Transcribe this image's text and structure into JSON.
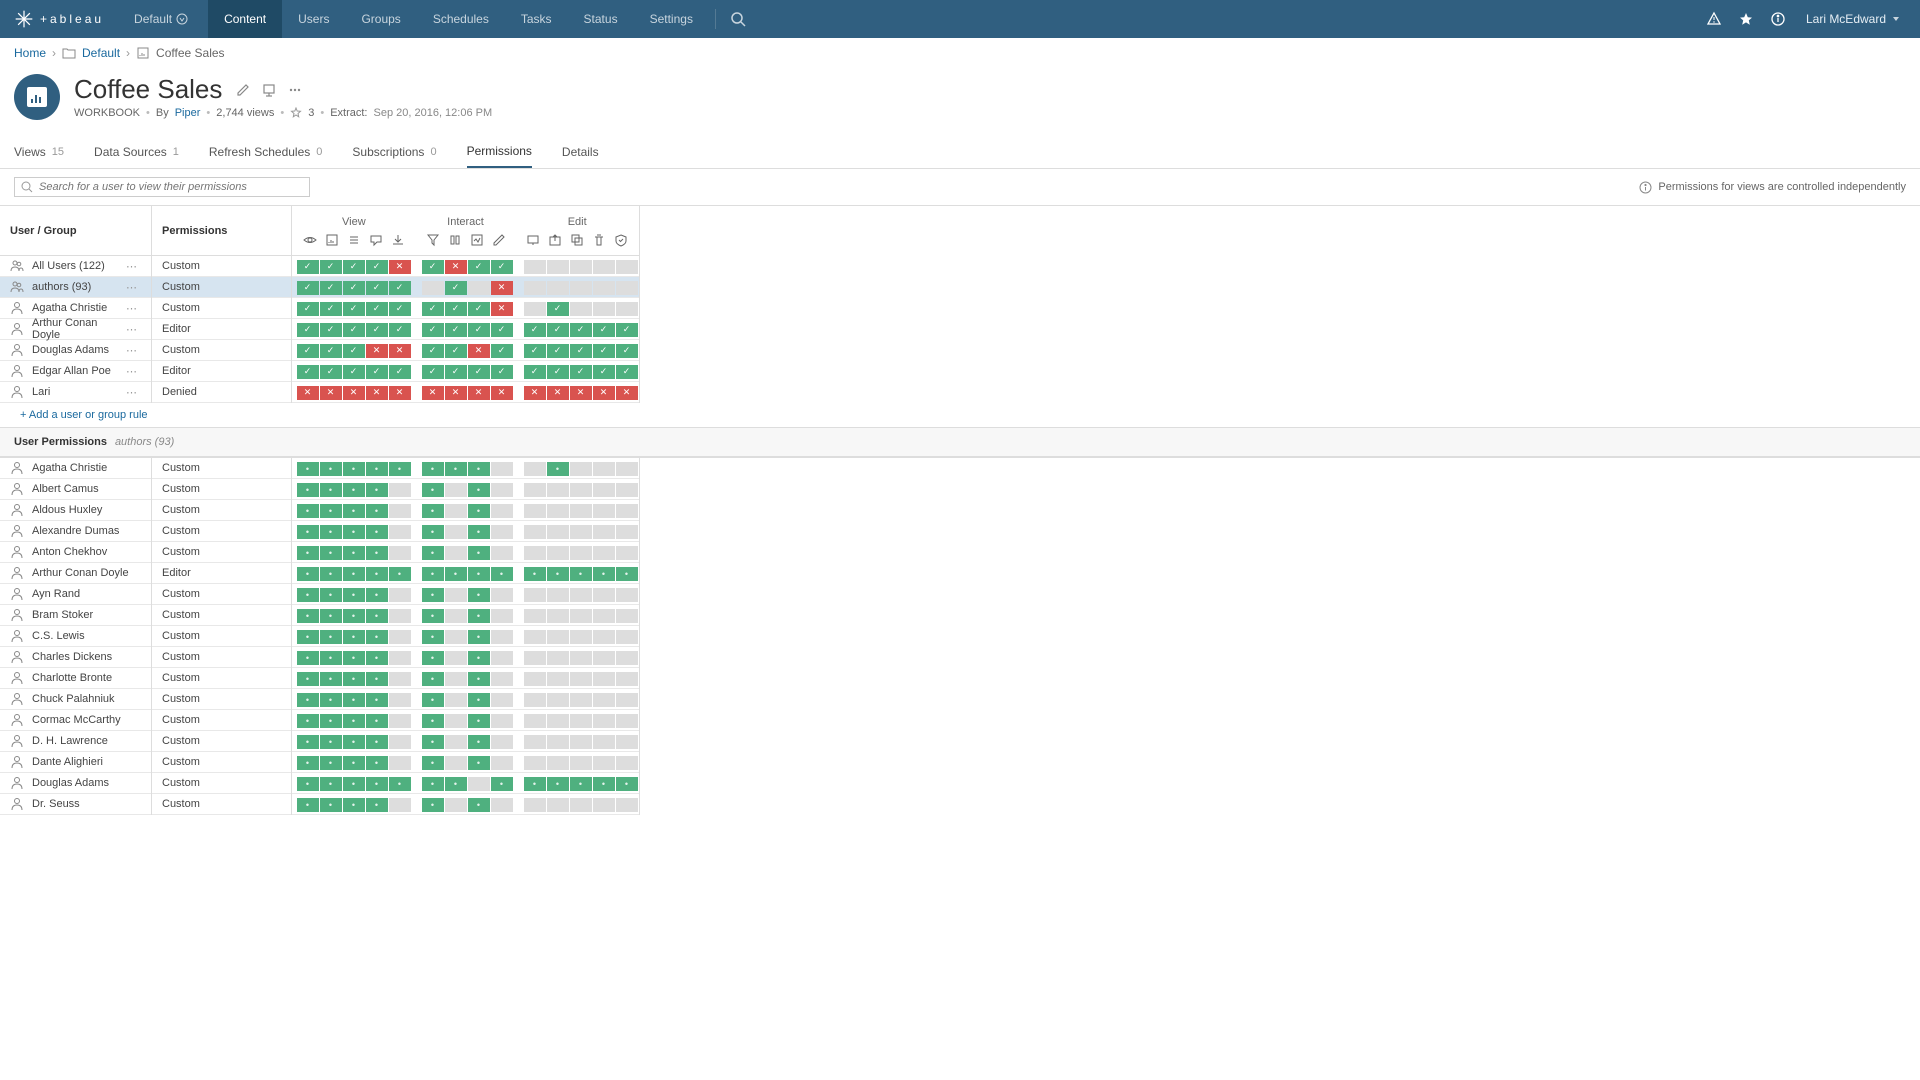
{
  "topnav": {
    "site": "Default",
    "items": [
      "Content",
      "Users",
      "Groups",
      "Schedules",
      "Tasks",
      "Status",
      "Settings"
    ],
    "active": "Content",
    "user": "Lari McEdward"
  },
  "breadcrumb": {
    "home": "Home",
    "project": "Default",
    "workbook": "Coffee Sales"
  },
  "workbook": {
    "title": "Coffee Sales",
    "type": "WORKBOOK",
    "by_label": "By",
    "owner": "Piper",
    "views": "2,744 views",
    "fav_count": "3",
    "extract_label": "Extract:",
    "extract_value": "Sep 20, 2016, 12:06 PM"
  },
  "tabs": [
    {
      "label": "Views",
      "count": "15"
    },
    {
      "label": "Data Sources",
      "count": "1"
    },
    {
      "label": "Refresh Schedules",
      "count": "0"
    },
    {
      "label": "Subscriptions",
      "count": "0"
    },
    {
      "label": "Permissions",
      "count": ""
    },
    {
      "label": "Details",
      "count": ""
    }
  ],
  "active_tab": "Permissions",
  "search_placeholder": "Search for a user to view their permissions",
  "info_note": "Permissions for views are controlled independently",
  "grid": {
    "user_group_header": "User / Group",
    "perm_header": "Permissions",
    "groups": [
      "View",
      "Interact",
      "Edit"
    ],
    "group_caps": [
      5,
      4,
      5
    ],
    "rules": [
      {
        "name": "All Users (122)",
        "kind": "group",
        "role": "Custom",
        "cells": [
          [
            "a",
            "a",
            "a",
            "a",
            "d"
          ],
          [
            "a",
            "d",
            "a",
            "a"
          ],
          [
            "n",
            "n",
            "n",
            "n",
            "n"
          ]
        ]
      },
      {
        "name": "authors (93)",
        "kind": "group",
        "role": "Custom",
        "sel": true,
        "cells": [
          [
            "a",
            "a",
            "a",
            "a",
            "a"
          ],
          [
            "n",
            "a",
            "n",
            "d"
          ],
          [
            "n",
            "n",
            "n",
            "n",
            "n"
          ]
        ]
      },
      {
        "name": "Agatha Christie",
        "kind": "user",
        "role": "Custom",
        "cells": [
          [
            "a",
            "a",
            "a",
            "a",
            "a"
          ],
          [
            "a",
            "a",
            "a",
            "d"
          ],
          [
            "n",
            "a",
            "n",
            "n",
            "n"
          ]
        ]
      },
      {
        "name": "Arthur Conan Doyle",
        "kind": "user",
        "role": "Editor",
        "cells": [
          [
            "a",
            "a",
            "a",
            "a",
            "a"
          ],
          [
            "a",
            "a",
            "a",
            "a"
          ],
          [
            "a",
            "a",
            "a",
            "a",
            "a"
          ]
        ]
      },
      {
        "name": "Douglas Adams",
        "kind": "user",
        "role": "Custom",
        "cells": [
          [
            "a",
            "a",
            "a",
            "d",
            "d"
          ],
          [
            "a",
            "a",
            "d",
            "a"
          ],
          [
            "a",
            "a",
            "a",
            "a",
            "a"
          ]
        ]
      },
      {
        "name": "Edgar Allan Poe",
        "kind": "user",
        "role": "Editor",
        "cells": [
          [
            "a",
            "a",
            "a",
            "a",
            "a"
          ],
          [
            "a",
            "a",
            "a",
            "a"
          ],
          [
            "a",
            "a",
            "a",
            "a",
            "a"
          ]
        ]
      },
      {
        "name": "Lari",
        "kind": "user",
        "role": "Denied",
        "cells": [
          [
            "d",
            "d",
            "d",
            "d",
            "d"
          ],
          [
            "d",
            "d",
            "d",
            "d"
          ],
          [
            "d",
            "d",
            "d",
            "d",
            "d"
          ]
        ]
      }
    ],
    "add_rule": "+ Add a user or group rule",
    "user_perms_header": "User Permissions",
    "user_perms_sub": "authors (93)",
    "user_rows": [
      {
        "name": "Agatha Christie",
        "role": "Custom",
        "cells": [
          [
            "p",
            "p",
            "p",
            "p",
            "p"
          ],
          [
            "p",
            "p",
            "p",
            "n"
          ],
          [
            "n",
            "p",
            "n",
            "n",
            "n"
          ]
        ]
      },
      {
        "name": "Albert Camus",
        "role": "Custom",
        "cells": [
          [
            "p",
            "p",
            "p",
            "p",
            "n"
          ],
          [
            "p",
            "n",
            "p",
            "n"
          ],
          [
            "n",
            "n",
            "n",
            "n",
            "n"
          ]
        ]
      },
      {
        "name": "Aldous Huxley",
        "role": "Custom",
        "cells": [
          [
            "p",
            "p",
            "p",
            "p",
            "n"
          ],
          [
            "p",
            "n",
            "p",
            "n"
          ],
          [
            "n",
            "n",
            "n",
            "n",
            "n"
          ]
        ]
      },
      {
        "name": "Alexandre Dumas",
        "role": "Custom",
        "cells": [
          [
            "p",
            "p",
            "p",
            "p",
            "n"
          ],
          [
            "p",
            "n",
            "p",
            "n"
          ],
          [
            "n",
            "n",
            "n",
            "n",
            "n"
          ]
        ]
      },
      {
        "name": "Anton Chekhov",
        "role": "Custom",
        "cells": [
          [
            "p",
            "p",
            "p",
            "p",
            "n"
          ],
          [
            "p",
            "n",
            "p",
            "n"
          ],
          [
            "n",
            "n",
            "n",
            "n",
            "n"
          ]
        ]
      },
      {
        "name": "Arthur Conan Doyle",
        "role": "Editor",
        "cells": [
          [
            "p",
            "p",
            "p",
            "p",
            "p"
          ],
          [
            "p",
            "p",
            "p",
            "p"
          ],
          [
            "p",
            "p",
            "p",
            "p",
            "p"
          ]
        ]
      },
      {
        "name": "Ayn Rand",
        "role": "Custom",
        "cells": [
          [
            "p",
            "p",
            "p",
            "p",
            "n"
          ],
          [
            "p",
            "n",
            "p",
            "n"
          ],
          [
            "n",
            "n",
            "n",
            "n",
            "n"
          ]
        ]
      },
      {
        "name": "Bram Stoker",
        "role": "Custom",
        "cells": [
          [
            "p",
            "p",
            "p",
            "p",
            "n"
          ],
          [
            "p",
            "n",
            "p",
            "n"
          ],
          [
            "n",
            "n",
            "n",
            "n",
            "n"
          ]
        ]
      },
      {
        "name": "C.S. Lewis",
        "role": "Custom",
        "cells": [
          [
            "p",
            "p",
            "p",
            "p",
            "n"
          ],
          [
            "p",
            "n",
            "p",
            "n"
          ],
          [
            "n",
            "n",
            "n",
            "n",
            "n"
          ]
        ]
      },
      {
        "name": "Charles Dickens",
        "role": "Custom",
        "cells": [
          [
            "p",
            "p",
            "p",
            "p",
            "n"
          ],
          [
            "p",
            "n",
            "p",
            "n"
          ],
          [
            "n",
            "n",
            "n",
            "n",
            "n"
          ]
        ]
      },
      {
        "name": "Charlotte Bronte",
        "role": "Custom",
        "cells": [
          [
            "p",
            "p",
            "p",
            "p",
            "n"
          ],
          [
            "p",
            "n",
            "p",
            "n"
          ],
          [
            "n",
            "n",
            "n",
            "n",
            "n"
          ]
        ]
      },
      {
        "name": "Chuck Palahniuk",
        "role": "Custom",
        "cells": [
          [
            "p",
            "p",
            "p",
            "p",
            "n"
          ],
          [
            "p",
            "n",
            "p",
            "n"
          ],
          [
            "n",
            "n",
            "n",
            "n",
            "n"
          ]
        ]
      },
      {
        "name": "Cormac McCarthy",
        "role": "Custom",
        "cells": [
          [
            "p",
            "p",
            "p",
            "p",
            "n"
          ],
          [
            "p",
            "n",
            "p",
            "n"
          ],
          [
            "n",
            "n",
            "n",
            "n",
            "n"
          ]
        ]
      },
      {
        "name": "D. H. Lawrence",
        "role": "Custom",
        "cells": [
          [
            "p",
            "p",
            "p",
            "p",
            "n"
          ],
          [
            "p",
            "n",
            "p",
            "n"
          ],
          [
            "n",
            "n",
            "n",
            "n",
            "n"
          ]
        ]
      },
      {
        "name": "Dante Alighieri",
        "role": "Custom",
        "cells": [
          [
            "p",
            "p",
            "p",
            "p",
            "n"
          ],
          [
            "p",
            "n",
            "p",
            "n"
          ],
          [
            "n",
            "n",
            "n",
            "n",
            "n"
          ]
        ]
      },
      {
        "name": "Douglas Adams",
        "role": "Custom",
        "cells": [
          [
            "p",
            "p",
            "p",
            "p",
            "p"
          ],
          [
            "p",
            "p",
            "n",
            "p"
          ],
          [
            "p",
            "p",
            "p",
            "p",
            "p"
          ]
        ]
      },
      {
        "name": "Dr. Seuss",
        "role": "Custom",
        "cells": [
          [
            "p",
            "p",
            "p",
            "p",
            "n"
          ],
          [
            "p",
            "n",
            "p",
            "n"
          ],
          [
            "n",
            "n",
            "n",
            "n",
            "n"
          ]
        ]
      }
    ]
  }
}
